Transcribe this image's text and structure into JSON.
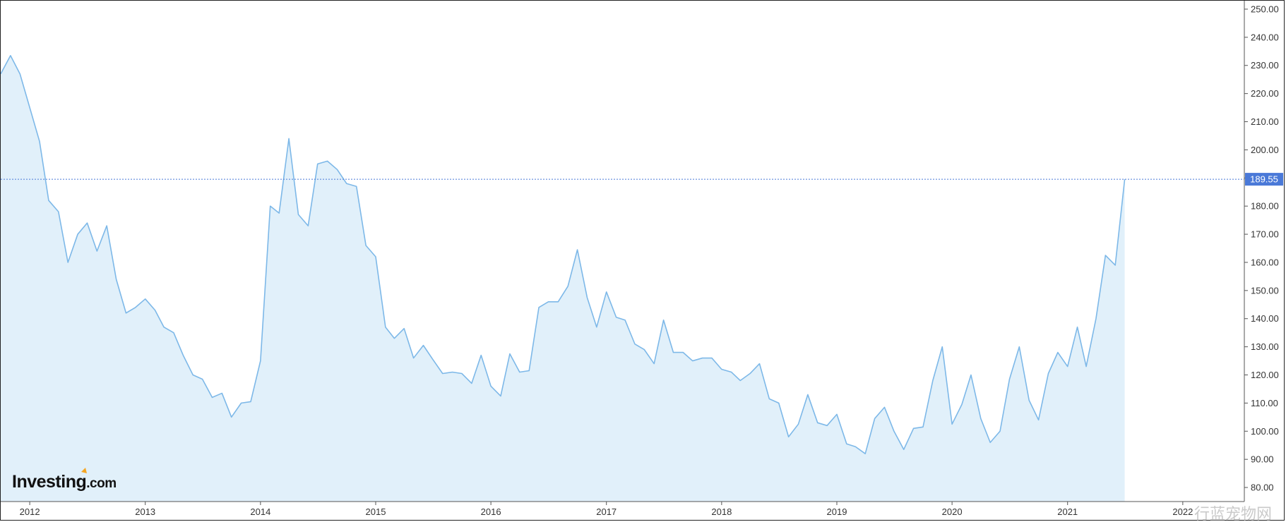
{
  "chart_data": {
    "type": "area",
    "xlim": [
      "2011-10-01",
      "2022-07-15"
    ],
    "ylim": [
      75,
      253
    ],
    "y_ticks": [
      80,
      90,
      100,
      110,
      120,
      130,
      140,
      150,
      160,
      170,
      180,
      190,
      200,
      210,
      220,
      230,
      240,
      250
    ],
    "y_tick_labels": [
      "80.00",
      "90.00",
      "100.00",
      "110.00",
      "120.00",
      "130.00",
      "140.00",
      "150.00",
      "160.00",
      "170.00",
      "180.00",
      "190.00",
      "200.00",
      "210.00",
      "220.00",
      "230.00",
      "240.00",
      "250.00"
    ],
    "x_ticks": [
      "2012-01-01",
      "2013-01-01",
      "2014-01-01",
      "2015-01-01",
      "2016-01-01",
      "2017-01-01",
      "2018-01-01",
      "2019-01-01",
      "2020-01-01",
      "2021-01-01",
      "2022-01-01"
    ],
    "x_tick_labels": [
      "2012",
      "2013",
      "2014",
      "2015",
      "2016",
      "2017",
      "2018",
      "2019",
      "2020",
      "2021",
      "2022"
    ],
    "grid": false,
    "legend": "none",
    "last_value": 189.55,
    "last_value_label": "189.55",
    "colors": {
      "line": "#7db8e8",
      "fill": "#e1f0fa",
      "price_tag": "#4a79d8",
      "ref_line": "#4a79d8"
    },
    "series": [
      {
        "x": [
          "2011-10-01",
          "2011-11-01",
          "2011-12-01",
          "2012-01-01",
          "2012-02-01",
          "2012-03-01",
          "2012-04-01",
          "2012-05-01",
          "2012-06-01",
          "2012-07-01",
          "2012-08-01",
          "2012-09-01",
          "2012-10-01",
          "2012-11-01",
          "2012-12-01",
          "2013-01-01",
          "2013-02-01",
          "2013-03-01",
          "2013-04-01",
          "2013-05-01",
          "2013-06-01",
          "2013-07-01",
          "2013-08-01",
          "2013-09-01",
          "2013-10-01",
          "2013-11-01",
          "2013-12-01",
          "2014-01-01",
          "2014-02-01",
          "2014-03-01",
          "2014-04-01",
          "2014-05-01",
          "2014-06-01",
          "2014-07-01",
          "2014-08-01",
          "2014-09-01",
          "2014-10-01",
          "2014-11-01",
          "2014-12-01",
          "2015-01-01",
          "2015-02-01",
          "2015-03-01",
          "2015-04-01",
          "2015-05-01",
          "2015-06-01",
          "2015-07-01",
          "2015-08-01",
          "2015-09-01",
          "2015-10-01",
          "2015-11-01",
          "2015-12-01",
          "2016-01-01",
          "2016-02-01",
          "2016-03-01",
          "2016-04-01",
          "2016-05-01",
          "2016-06-01",
          "2016-07-01",
          "2016-08-01",
          "2016-09-01",
          "2016-10-01",
          "2016-11-01",
          "2016-12-01",
          "2017-01-01",
          "2017-02-01",
          "2017-03-01",
          "2017-04-01",
          "2017-05-01",
          "2017-06-01",
          "2017-07-01",
          "2017-08-01",
          "2017-09-01",
          "2017-10-01",
          "2017-11-01",
          "2017-12-01",
          "2018-01-01",
          "2018-02-01",
          "2018-03-01",
          "2018-04-01",
          "2018-05-01",
          "2018-06-01",
          "2018-07-01",
          "2018-08-01",
          "2018-09-01",
          "2018-10-01",
          "2018-11-01",
          "2018-12-01",
          "2019-01-01",
          "2019-02-01",
          "2019-03-01",
          "2019-04-01",
          "2019-05-01",
          "2019-06-01",
          "2019-07-01",
          "2019-08-01",
          "2019-09-01",
          "2019-10-01",
          "2019-11-01",
          "2019-12-01",
          "2020-01-01",
          "2020-02-01",
          "2020-03-01",
          "2020-04-01",
          "2020-05-01",
          "2020-06-01",
          "2020-07-01",
          "2020-08-01",
          "2020-09-01",
          "2020-10-01",
          "2020-11-01",
          "2020-12-01",
          "2021-01-01",
          "2021-02-01",
          "2021-03-01",
          "2021-04-01",
          "2021-05-01",
          "2021-06-01",
          "2021-07-01"
        ],
        "y": [
          227,
          233.5,
          227,
          215,
          203,
          182,
          178,
          160,
          170,
          174,
          164,
          173,
          154,
          142,
          144,
          147,
          143,
          137,
          135,
          127,
          120,
          118.5,
          112,
          113.5,
          105,
          110,
          110.5,
          125,
          180,
          177.5,
          204,
          177,
          173,
          195,
          196,
          193,
          188,
          187,
          166,
          162,
          137,
          133,
          136.5,
          126,
          130.5,
          125.5,
          120.5,
          121,
          120.5,
          117,
          127,
          116,
          112.5,
          127.5,
          121,
          121.5,
          144,
          146,
          146,
          151.5,
          164.5,
          147.5,
          137,
          149.5,
          140.5,
          139.5,
          131,
          129,
          124,
          139.5,
          128,
          128,
          125,
          126,
          126,
          122,
          121,
          118,
          120.5,
          124,
          111.5,
          110,
          98,
          102.5,
          113,
          103,
          102,
          106,
          95.5,
          94.5,
          92,
          104.5,
          108.5,
          100,
          93.5,
          101,
          101.5,
          118,
          130,
          102.5,
          109.5,
          120,
          104.5,
          96,
          100,
          118.5,
          130,
          111,
          104,
          120.5,
          128,
          123,
          137,
          123,
          140,
          162.5,
          159,
          189.55
        ]
      }
    ]
  },
  "branding": {
    "logo_main": "Investing",
    "logo_domain": ".com",
    "watermark": "行蓝宠物网"
  }
}
